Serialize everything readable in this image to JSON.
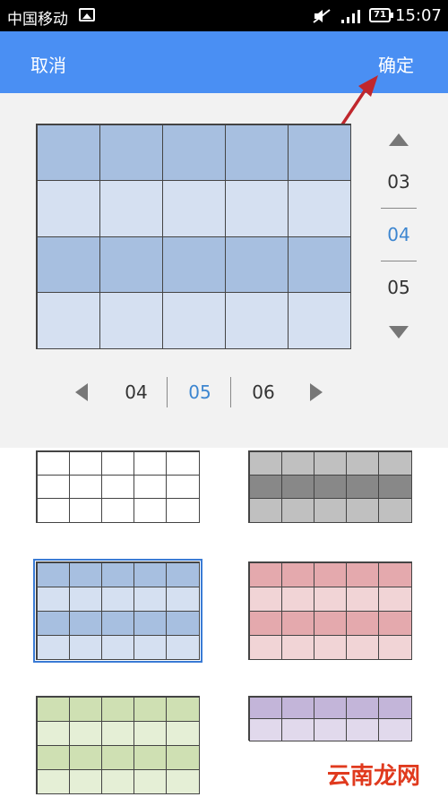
{
  "status_bar": {
    "carrier": "中国移动",
    "battery": "71",
    "time": "15:07"
  },
  "toolbar": {
    "cancel_label": "取消",
    "ok_label": "确定"
  },
  "preview": {
    "rows": 4,
    "cols": 5,
    "row_colors": [
      "#a7bfe0",
      "#d5e0f1",
      "#a7bfe0",
      "#d5e0f1"
    ]
  },
  "row_stepper": {
    "options": [
      "03",
      "04",
      "05"
    ],
    "selected": "04"
  },
  "col_stepper": {
    "options": [
      "04",
      "05",
      "06"
    ],
    "selected": "05"
  },
  "themes": [
    {
      "name": "white",
      "rows": 3,
      "colors": [
        "#ffffff",
        "#ffffff",
        "#ffffff"
      ],
      "selected": false
    },
    {
      "name": "gray",
      "rows": 3,
      "colors": [
        "#c0c0c0",
        "#888888",
        "#c0c0c0"
      ],
      "selected": false
    },
    {
      "name": "blue",
      "rows": 4,
      "colors": [
        "#a7bfe0",
        "#d5e0f1",
        "#a7bfe0",
        "#d5e0f1"
      ],
      "selected": true
    },
    {
      "name": "red",
      "rows": 4,
      "colors": [
        "#e4a9ad",
        "#f1d4d6",
        "#e4a9ad",
        "#f1d4d6"
      ],
      "selected": false
    },
    {
      "name": "green",
      "rows": 4,
      "colors": [
        "#cfe0b3",
        "#e5efd6",
        "#cfe0b3",
        "#e5efd6"
      ],
      "selected": false
    },
    {
      "name": "purple",
      "rows": 2,
      "colors": [
        "#c3b5d9",
        "#e1d9ec"
      ],
      "selected": false
    }
  ],
  "colors": {
    "accent": "#4a8ff3",
    "selected_number": "#3d86d0",
    "annotation_arrow": "#c0272d"
  },
  "watermark": "云南龙网"
}
